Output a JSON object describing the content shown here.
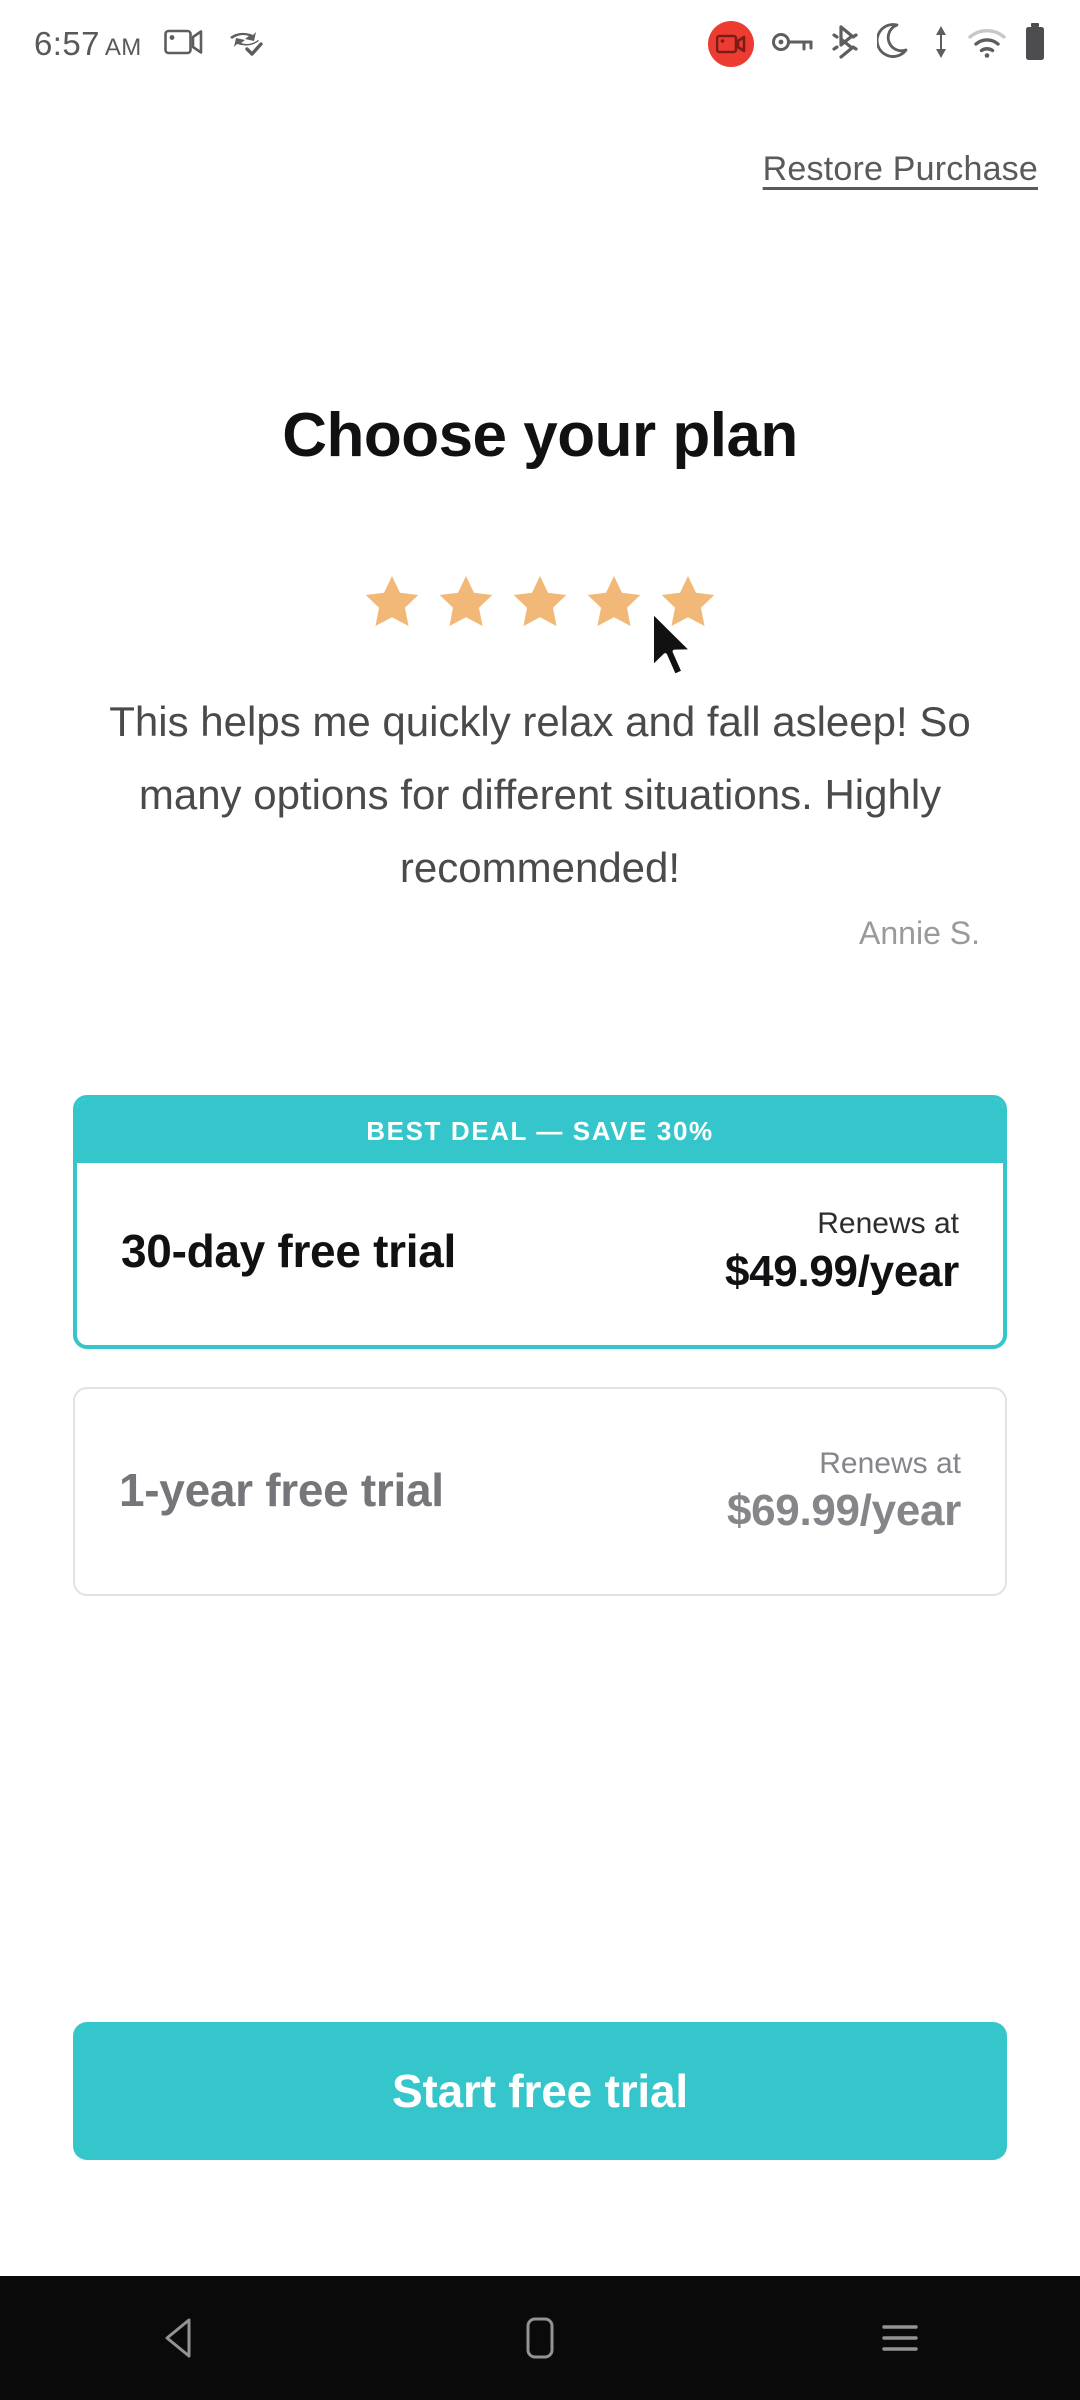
{
  "status_bar": {
    "time": "6:57",
    "ampm": "AM",
    "left_icons": [
      "screen-record-video-icon",
      "data-saver-check-icon"
    ],
    "right_icons": [
      "screen-recording-active-icon",
      "vpn-key-icon",
      "bluetooth-icon",
      "do-not-disturb-moon-icon",
      "mobile-data-arrows-icon",
      "wifi-icon",
      "battery-icon"
    ],
    "recording_badge_color": "#ec3c32"
  },
  "header": {
    "restore_label": "Restore Purchase"
  },
  "main": {
    "title": "Choose your plan",
    "rating": {
      "stars_filled": 5,
      "stars_total": 5,
      "star_color": "#f2b878"
    },
    "review": {
      "text": "This helps me quickly relax and fall asleep! So many options for different situations. Highly recommended!",
      "author": "Annie S."
    },
    "plans": [
      {
        "badge": "BEST DEAL — SAVE 30%",
        "name": "30-day free trial",
        "renews_label": "Renews at",
        "price": "$49.99/year",
        "selected": true
      },
      {
        "badge": "",
        "name": "1-year free trial",
        "renews_label": "Renews at",
        "price": "$69.99/year",
        "selected": false
      }
    ]
  },
  "cta": {
    "label": "Start free trial"
  },
  "nav_bar": {
    "back_label": "back-button",
    "home_label": "home-button",
    "recents_label": "recents-button"
  },
  "theme": {
    "accent": "#35c6cc",
    "title_color": "#111114",
    "muted_text": "#85858a"
  }
}
